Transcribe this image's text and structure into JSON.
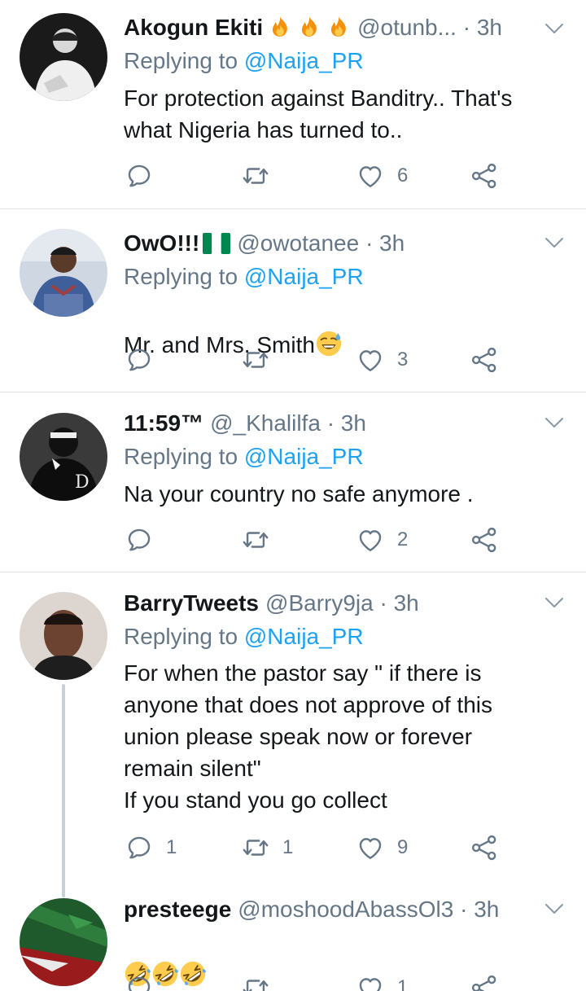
{
  "tweets": [
    {
      "name": "Akogun Ekiti",
      "name_emojis": [
        "fire-icon",
        "fire-icon",
        "fire-icon"
      ],
      "handle": "@otunb...",
      "time": "· 3h",
      "replying_label": "Replying to",
      "replying_to": "@Naija_PR",
      "text": "For protection against Banditry.. That's what Nigeria has turned to..",
      "replies": "",
      "retweets": "",
      "likes": "6"
    },
    {
      "name": "OwO!!!",
      "name_emojis": [
        "nigeria-flag-icon"
      ],
      "handle": "@owotanee",
      "time": "· 3h",
      "replying_label": "Replying to",
      "replying_to": "@Naija_PR",
      "text": "Mr. and Mrs. Smith",
      "text_emoji": "sweat-smile-icon",
      "replies": "",
      "retweets": "",
      "likes": "3"
    },
    {
      "name": "11:59™",
      "handle": "@_Khalilfa",
      "time": "· 3h",
      "replying_label": "Replying to",
      "replying_to": "@Naija_PR",
      "text": "Na your country no safe anymore .",
      "replies": "",
      "retweets": "",
      "likes": "2"
    },
    {
      "name": "BarryTweets",
      "handle": "@Barry9ja",
      "time": "· 3h",
      "replying_label": "Replying to",
      "replying_to": "@Naija_PR",
      "text": "For when the pastor say \" if there is anyone that does not approve of this union please speak now or forever remain silent\"\nIf you stand you go collect",
      "replies": "1",
      "retweets": "1",
      "likes": "9"
    },
    {
      "name": "presteege",
      "handle": "@moshoodAbassOl3",
      "time": "· 3h",
      "text_emojis": [
        "rolling-laughing-icon",
        "rolling-laughing-icon",
        "rolling-laughing-icon"
      ],
      "replies": "",
      "retweets": "",
      "likes": "1"
    }
  ],
  "colors": {
    "link": "#1da1f2",
    "secondary_text": "#657786",
    "primary_text": "#14171a",
    "divider": "#dfe3e6"
  }
}
